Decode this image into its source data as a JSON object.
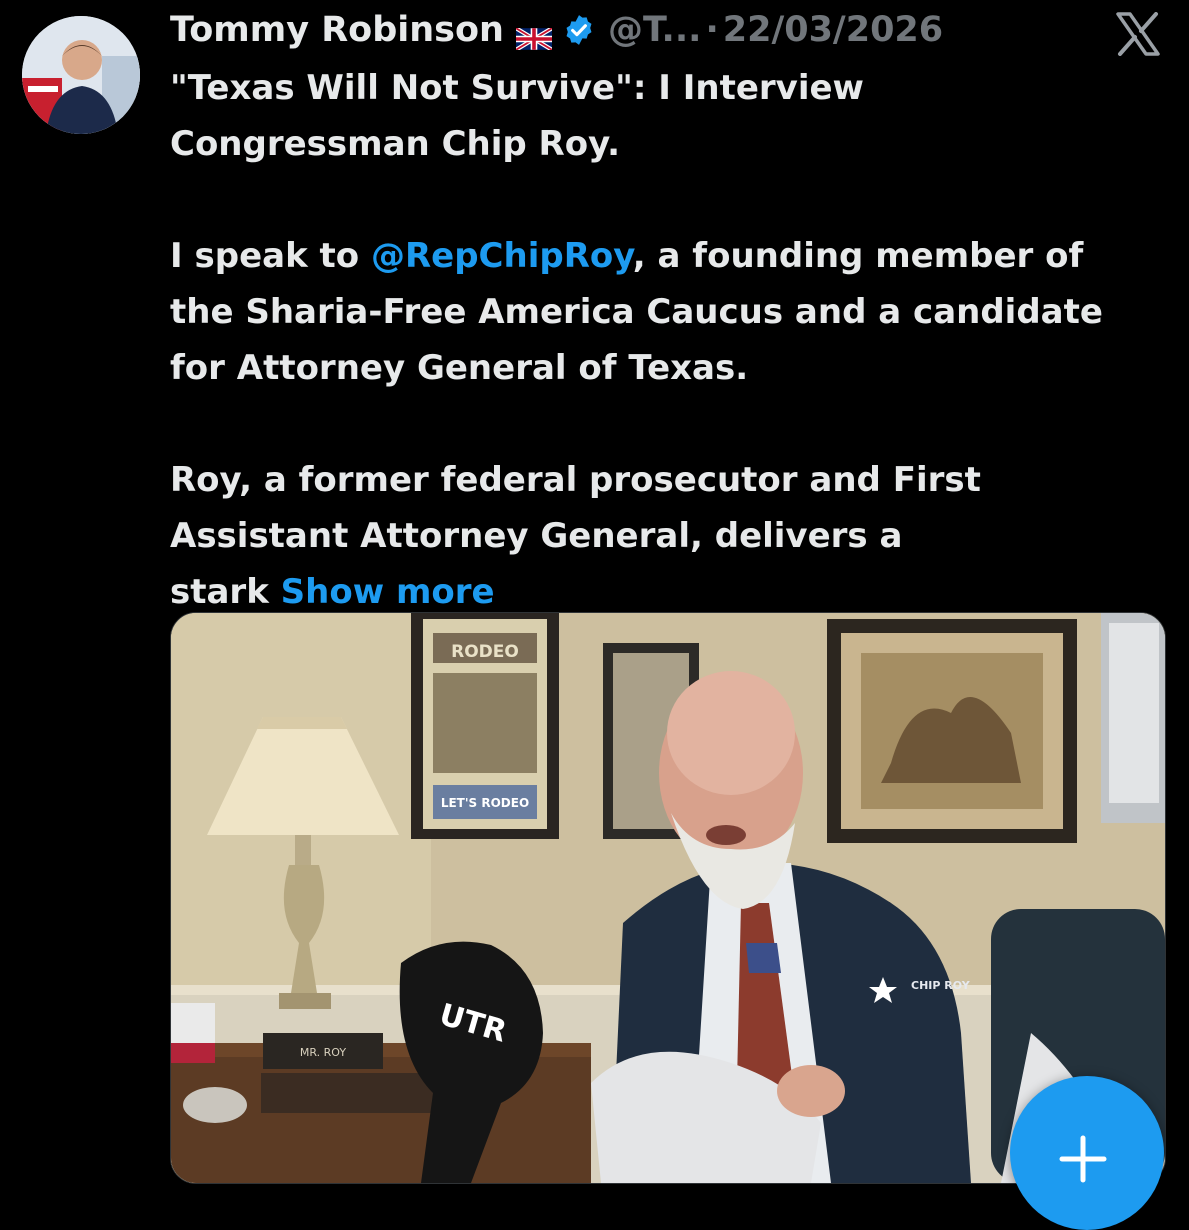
{
  "tweet": {
    "display_name": "Tommy Robinson",
    "handle": "@T...",
    "separator": "·",
    "timestamp": "22/03/2026",
    "flag_icon": "uk-flag-icon",
    "verified_icon": "verified-badge-icon",
    "platform_icon": "x-logo-icon",
    "title_line_1": "\"Texas Will Not Survive\": I Interview",
    "title_line_2": "Congressman Chip Roy.",
    "para2_lead": "I speak to ",
    "mention": "@RepChipRoy",
    "para2_rest_1": ", a founding member of",
    "para2_line_2": "the Sharia-Free America Caucus and a candidate",
    "para2_line_3": "for Attorney General of Texas.",
    "para3_line_1": "Roy, a former federal prosecutor and First",
    "para3_line_2": "Assistant Attorney General, delivers a",
    "para3_line_3_lead": "stark ",
    "show_more": "Show more"
  },
  "media": {
    "poster_text": "RODEO",
    "poster_subtext": "LET'S RODEO",
    "nameplate": "MR. ROY",
    "vest_logo": "CHIP ROY",
    "mic_logo": "UTR"
  },
  "fab": {
    "icon": "plus-icon"
  },
  "colors": {
    "background": "#000000",
    "text_primary": "#e7e9ea",
    "text_secondary": "#71767b",
    "accent": "#1d9bf0"
  }
}
